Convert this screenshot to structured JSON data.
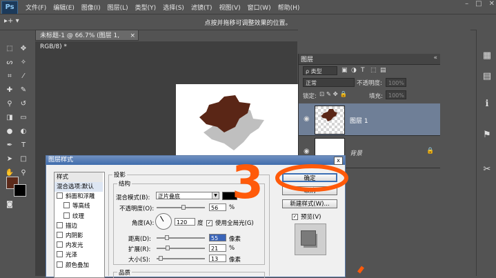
{
  "app": {
    "logo": "Ps"
  },
  "menu": [
    "文件(F)",
    "编辑(E)",
    "图像(I)",
    "图层(L)",
    "类型(Y)",
    "选择(S)",
    "滤镜(T)",
    "视图(V)",
    "窗口(W)",
    "帮助(H)"
  ],
  "window_controls": {
    "minimize": "–",
    "restore": "□",
    "close": "✕"
  },
  "options_bar": {
    "tool_glyph": "▸+ ▾",
    "hint": "点按并拖移可调整效果的位置。"
  },
  "document_tab": {
    "title": "未标题-1 @ 66.7% (图层 1, RGB/8) *",
    "close": "×"
  },
  "colors": {
    "foreground": "#5c2a1a",
    "background": "#000000",
    "shape": "#5a2616",
    "shadow": "#8a8a8a",
    "dialog_title": "#3f6cac",
    "annotation": "#ff5a0a"
  },
  "layers_panel": {
    "tab": "图层",
    "collapse": "«",
    "kind_filter": "ρ 类型",
    "blend_mode": "正常",
    "opacity_label": "不透明度:",
    "opacity_value": "100%",
    "lock_label": "锁定:",
    "lock_glyphs": "⊡ ✎ ✥ 🔒",
    "fill_label": "填充:",
    "fill_value": "100%",
    "layers": [
      {
        "name": "图层 1",
        "visible": true,
        "selected": true
      },
      {
        "name": "背景",
        "visible": true,
        "selected": false,
        "locked": true
      }
    ]
  },
  "dialog": {
    "title": "图层样式",
    "close": "x",
    "styles_header": "样式",
    "styles": [
      {
        "label": "混合选项:默认",
        "checkbox": false,
        "indent": 0
      },
      {
        "label": "斜面和浮雕",
        "checkbox": true,
        "indent": 0
      },
      {
        "label": "等高线",
        "checkbox": true,
        "indent": 1
      },
      {
        "label": "纹理",
        "checkbox": true,
        "indent": 1
      },
      {
        "label": "描边",
        "checkbox": true,
        "indent": 0
      },
      {
        "label": "内阴影",
        "checkbox": true,
        "indent": 0
      },
      {
        "label": "内发光",
        "checkbox": true,
        "indent": 0
      },
      {
        "label": "光泽",
        "checkbox": true,
        "indent": 0
      },
      {
        "label": "颜色叠加",
        "checkbox": true,
        "indent": 0
      }
    ],
    "section_title": "投影",
    "structure_title": "结构",
    "blend_mode_label": "混合模式(B):",
    "blend_mode_value": "正片叠底",
    "opacity_label": "不透明度(O):",
    "opacity_value": "56",
    "opacity_unit": "%",
    "opacity_level": 0.56,
    "angle_label": "角度(A):",
    "angle_value": "120",
    "angle_unit": "度",
    "global_light_label": "使用全局光(G)",
    "distance_label": "距离(D):",
    "distance_value": "55",
    "distance_unit": "像素",
    "distance_level": 0.18,
    "spread_label": "扩展(R):",
    "spread_value": "21",
    "spread_unit": "%",
    "spread_level": 0.21,
    "size_label": "大小(S):",
    "size_value": "13",
    "size_unit": "像素",
    "size_level": 0.05,
    "quality_title": "品质",
    "ok_button": "确定",
    "cancel_button": "取消",
    "new_style_button": "新建样式(W)...",
    "preview_label": "预览(V)"
  },
  "annotation": {
    "text": "3"
  }
}
